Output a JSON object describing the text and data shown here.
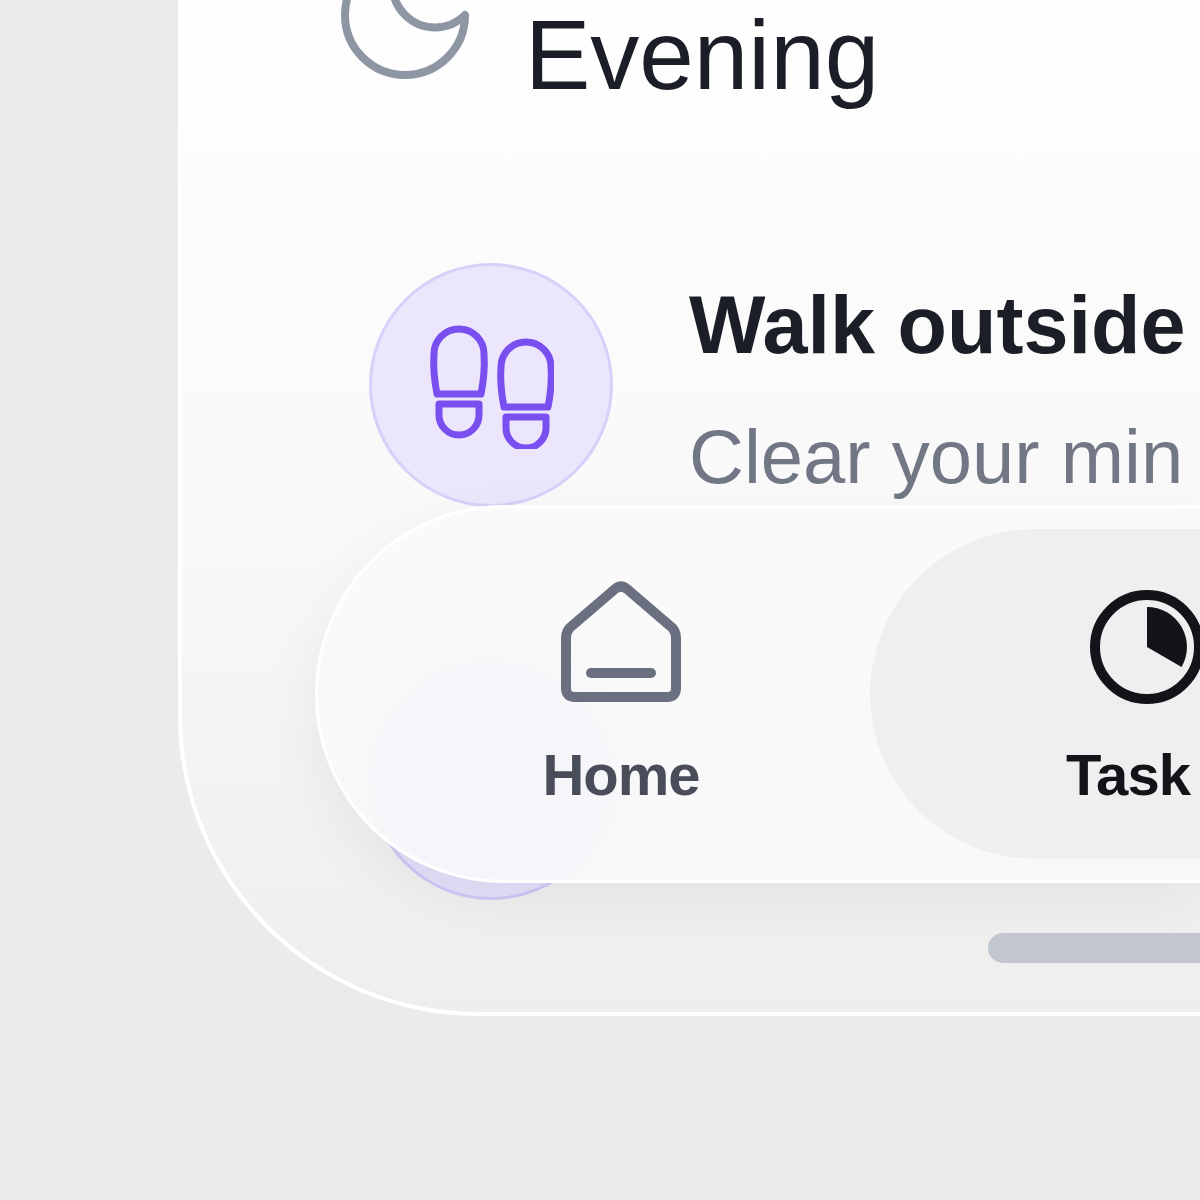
{
  "section": {
    "title": "Evening"
  },
  "tasks": [
    {
      "title": "Walk outside",
      "subtitle": "Clear your min"
    }
  ],
  "tab_bar": {
    "tabs": [
      {
        "label": "Home",
        "kind": "home",
        "selected": false
      },
      {
        "label": "Task",
        "kind": "timer",
        "selected": true
      }
    ]
  }
}
